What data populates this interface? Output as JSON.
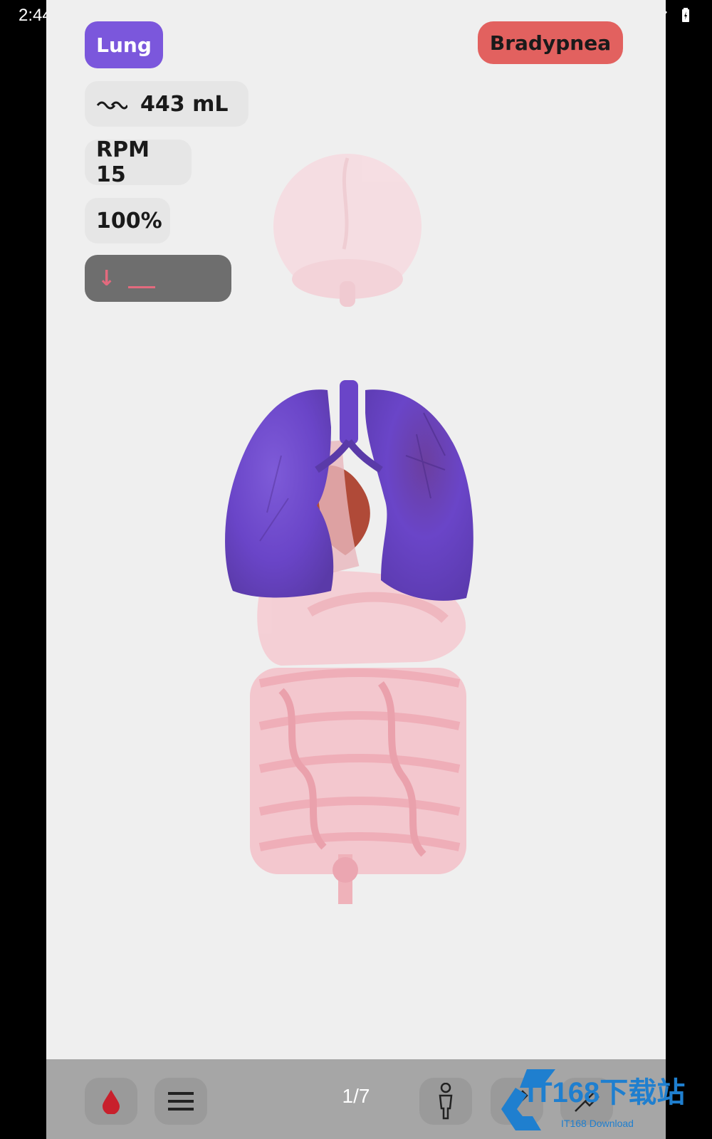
{
  "status_bar": {
    "time": "2:44",
    "left_icons": [
      "image-icon",
      "grid-icon",
      "sim-icon"
    ],
    "right_icons": [
      "dnd-icon",
      "wifi-icon",
      "battery-icon"
    ]
  },
  "organ_mode": {
    "label": "Lung",
    "color": "#7b57dc"
  },
  "status_badge": {
    "label": "Bradypnea",
    "color": "#e2615f"
  },
  "metrics": {
    "volume": "443 mL",
    "volume_icon": "wave-icon",
    "rate": "RPM 15",
    "percent": "100%",
    "trend_icon": "arrow-down-icon"
  },
  "bottom_bar": {
    "page_indicator": "1/7",
    "buttons": [
      "blood-drop-icon",
      "menu-icon",
      "body-icon",
      "pen-icon",
      "tool-icon"
    ]
  },
  "watermark": {
    "title": "IT168下载站",
    "subtitle": "IT168 Download"
  },
  "colors": {
    "lung": "#6a45c8",
    "organ_pink": "#f2a4ae",
    "background": "#efefef"
  }
}
